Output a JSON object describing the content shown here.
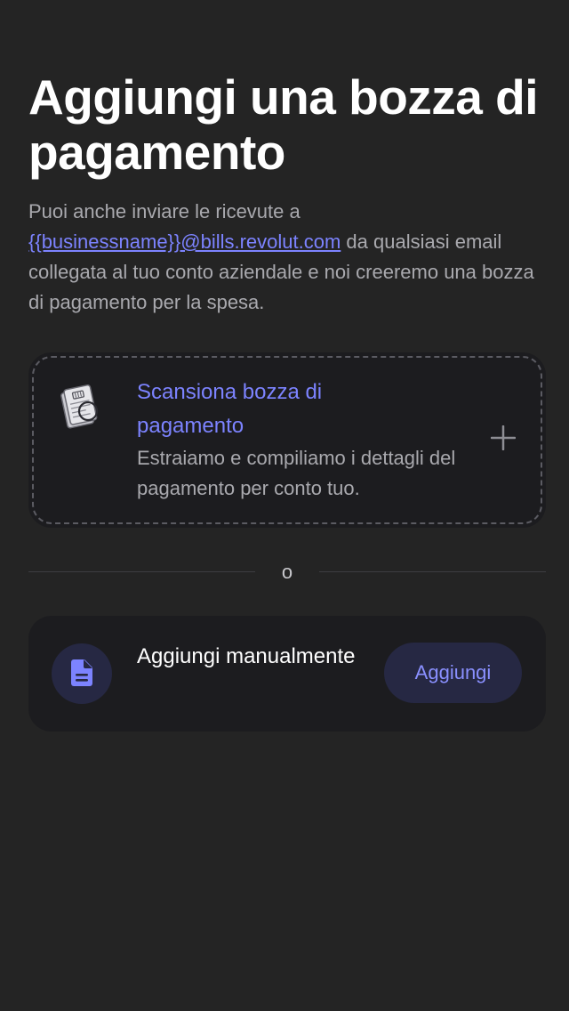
{
  "header": {
    "title": "Aggiungi una bozza di pagamento"
  },
  "description": {
    "text_before": "Puoi anche inviare le ricevute a ",
    "email_link": "{{businessname}}@bills.revolut.com",
    "text_after": " da qualsiasi email collegata al tuo conto aziendale e noi creeremo una bozza di pagamento per la spesa."
  },
  "scan_card": {
    "icon": "receipt-scan-icon",
    "title": "Scansiona bozza di pagamento",
    "description": "Estraiamo e compiliamo i dettagli del pagamento per conto tuo.",
    "action_icon": "plus-icon"
  },
  "divider": {
    "label": "o"
  },
  "manual_card": {
    "icon": "document-icon",
    "label": "Aggiungi manualmente",
    "button_label": "Aggiungi"
  },
  "colors": {
    "background": "#242424",
    "card": "#1c1c1f",
    "accent": "#7c83ff",
    "muted_text": "#a9a9ae",
    "button_bg": "#262843"
  }
}
